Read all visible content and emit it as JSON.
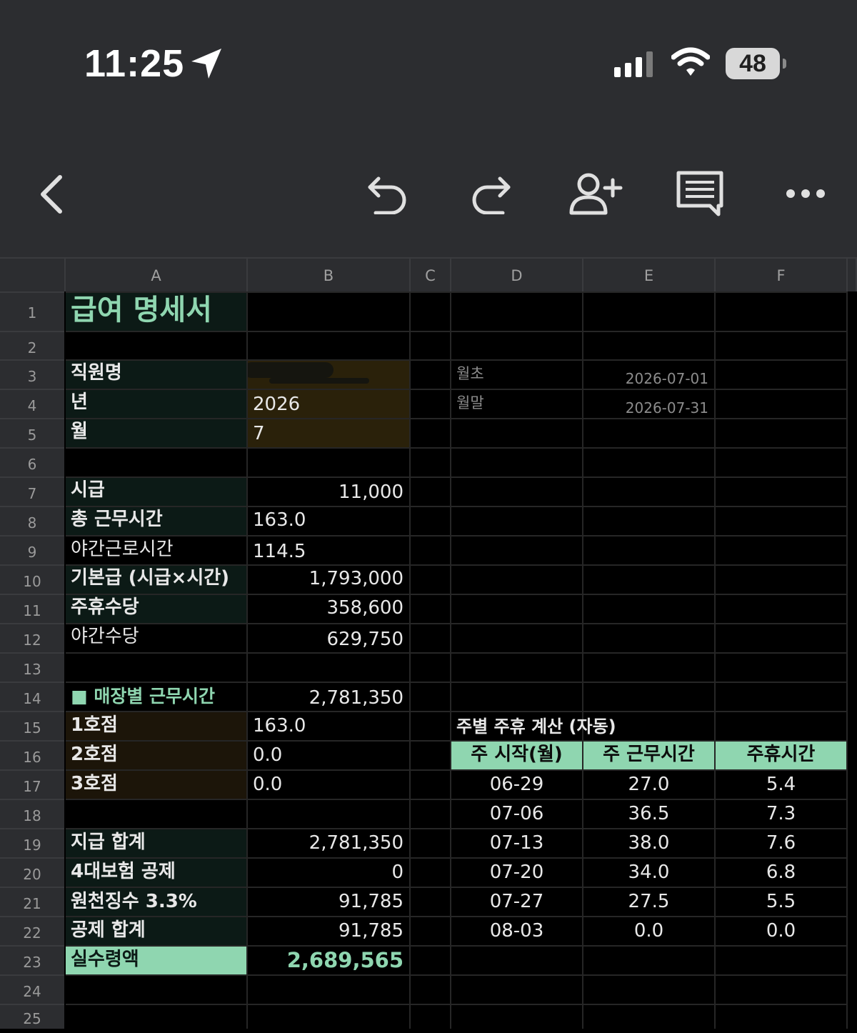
{
  "status": {
    "time": "11:25",
    "battery": "48"
  },
  "columns": [
    "A",
    "B",
    "C",
    "D",
    "E",
    "F"
  ],
  "rows": [
    "1",
    "2",
    "3",
    "4",
    "5",
    "6",
    "7",
    "8",
    "9",
    "10",
    "11",
    "12",
    "13",
    "14",
    "15",
    "16",
    "17",
    "18",
    "19",
    "20",
    "21",
    "22",
    "23",
    "24",
    "25"
  ],
  "cells": {
    "title": "급여 명세서",
    "a3": "직원명",
    "a4": "년",
    "a5": "월",
    "b4": "2026",
    "b5": "7",
    "d3": "월초",
    "e3": "2026-07-01",
    "d4": "월말",
    "e4": "2026-07-31",
    "a7": "시급",
    "b7": "11,000",
    "a8": "총 근무시간",
    "b8": "163.0",
    "a9": "야간근로시간",
    "b9": "114.5",
    "a10": "기본급 (시급×시간)",
    "b10": "1,793,000",
    "a11": "주휴수당",
    "b11": "358,600",
    "a12": "야간수당",
    "b12": "629,750",
    "a14": "■ 매장별 근무시간",
    "b14": "2,781,350",
    "a15": "1호점",
    "b15": "163.0",
    "a16": "2호점",
    "b16": "0.0",
    "a17": "3호점",
    "b17": "0.0",
    "a19": "지급 합계",
    "b19": "2,781,350",
    "a20": "4대보험 공제",
    "b20": "0",
    "a21": "원천징수 3.3%",
    "b21": "91,785",
    "a22": "공제 합계",
    "b22": "91,785",
    "a23": "실수령액",
    "b23": "2,689,565",
    "d15": "주별 주휴 계산 (자동)"
  },
  "weekly": {
    "headers": [
      "주 시작(월)",
      "주 근무시간",
      "주휴시간"
    ],
    "rows": [
      [
        "06-29",
        "27.0",
        "5.4"
      ],
      [
        "07-06",
        "36.5",
        "7.3"
      ],
      [
        "07-13",
        "38.0",
        "7.6"
      ],
      [
        "07-20",
        "34.0",
        "6.8"
      ],
      [
        "07-27",
        "27.5",
        "5.5"
      ],
      [
        "08-03",
        "0.0",
        "0.0"
      ]
    ]
  },
  "colors": {
    "accent": "#8fd6b0",
    "header_bg": "#2c2d30",
    "input_bg": "#2a210a"
  }
}
